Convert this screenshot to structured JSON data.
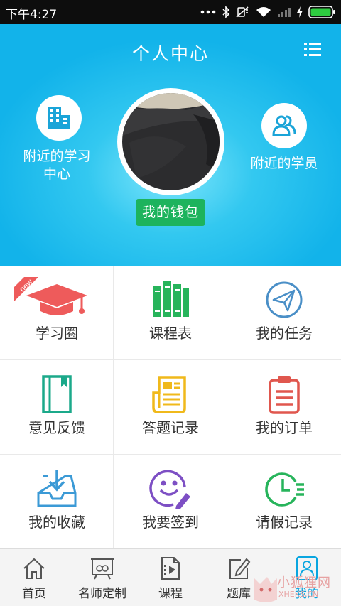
{
  "status_bar": {
    "time": "下午4:27",
    "icons": [
      "more-dots-icon",
      "bluetooth-icon",
      "mute-icon",
      "wifi-icon",
      "signal-icon",
      "charging-icon",
      "battery-icon"
    ],
    "battery_color": "#2ecc40"
  },
  "header": {
    "title": "个人中心",
    "menu_icon": "list-menu-icon",
    "left_shortcut": {
      "label_line1": "附近的学习",
      "label_line2": "中心",
      "icon": "building-icon"
    },
    "right_shortcut": {
      "label": "附近的学员",
      "icon": "people-icon"
    },
    "wallet_button": "我的钱包",
    "gradient_colors": [
      "#7fe6fb",
      "#12b3ea"
    ],
    "wallet_color": "#1db35d"
  },
  "grid": [
    {
      "label": "学习圈",
      "icon": "graduation-cap-icon",
      "color": "#ee5b5b",
      "badge": "new"
    },
    {
      "label": "课程表",
      "icon": "books-icon",
      "color": "#27b45b"
    },
    {
      "label": "我的任务",
      "icon": "paper-plane-icon",
      "color": "#4a8fc7"
    },
    {
      "label": "意见反馈",
      "icon": "notebook-icon",
      "color": "#1ba98a"
    },
    {
      "label": "答题记录",
      "icon": "newspaper-icon",
      "color": "#f0b91b"
    },
    {
      "label": "我的订单",
      "icon": "clipboard-icon",
      "color": "#e0574e"
    },
    {
      "label": "我的收藏",
      "icon": "inbox-download-icon",
      "color": "#3b9ad6"
    },
    {
      "label": "我要签到",
      "icon": "smiley-pen-icon",
      "color": "#7d4fc4"
    },
    {
      "label": "请假记录",
      "icon": "fast-clock-icon",
      "color": "#27b45b"
    }
  ],
  "bottom_nav": [
    {
      "label": "首页",
      "icon": "home-icon",
      "active": false
    },
    {
      "label": "名师定制",
      "icon": "teacher-board-icon",
      "active": false
    },
    {
      "label": "课程",
      "icon": "video-file-icon",
      "active": false
    },
    {
      "label": "题库",
      "icon": "edit-note-icon",
      "active": false
    },
    {
      "label": "我的",
      "icon": "user-profile-icon",
      "active": true
    }
  ],
  "watermark": {
    "line1": "小狐狸网",
    "line2": "XHEKS.CN"
  },
  "active_color": "#0aa6e0"
}
